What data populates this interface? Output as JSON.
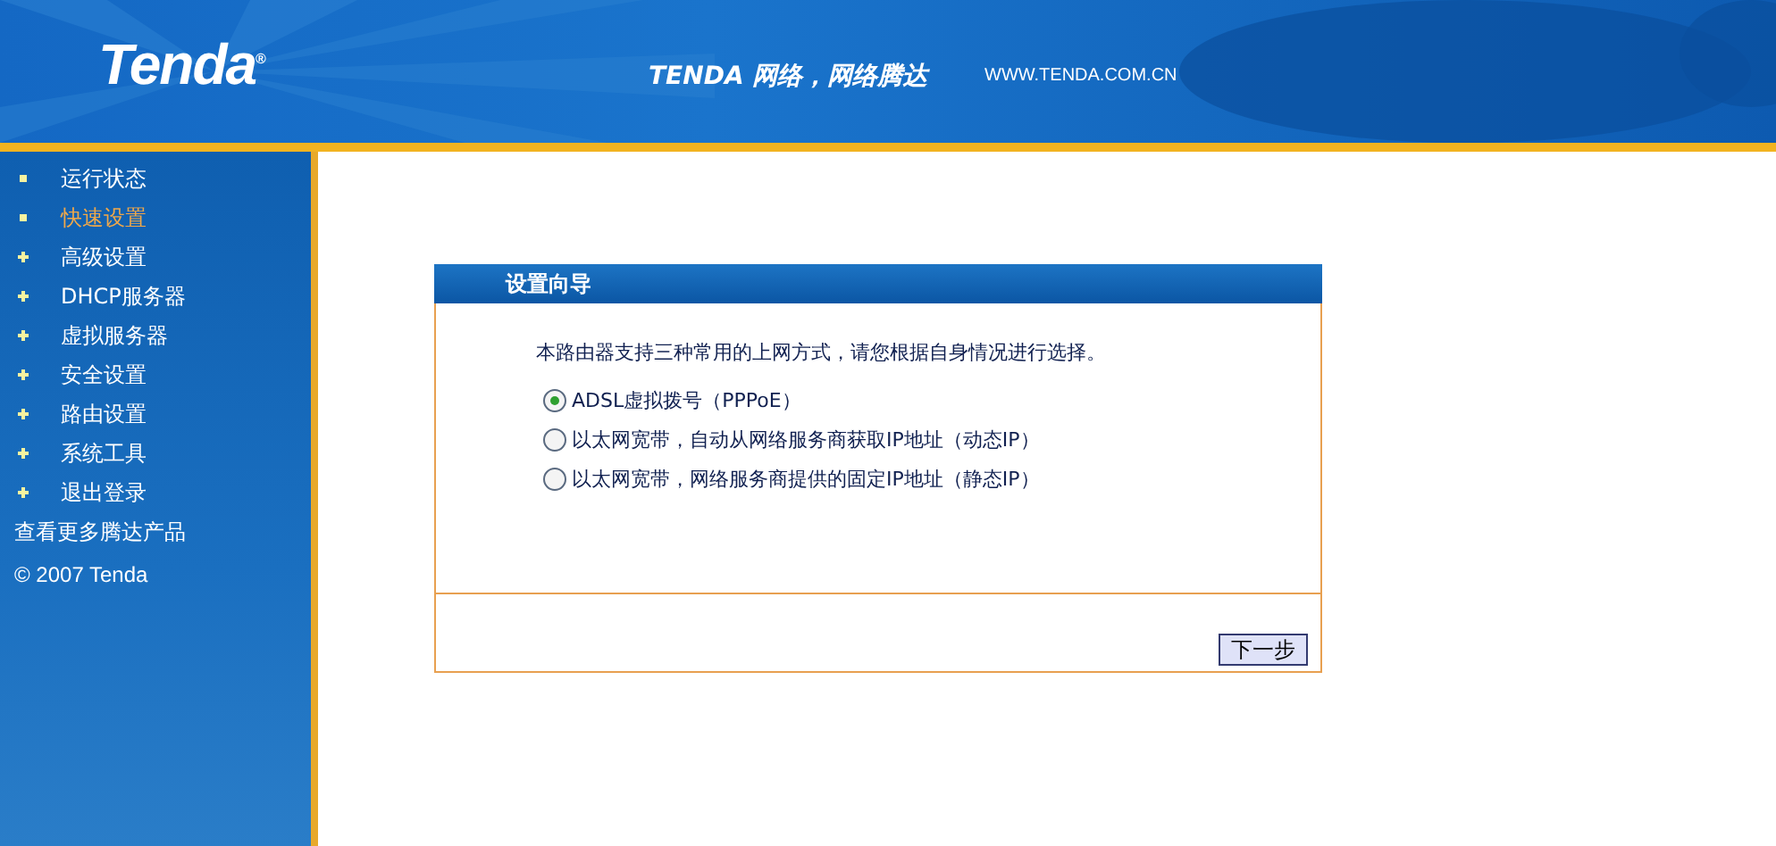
{
  "header": {
    "logo": "Tenda",
    "logo_mark": "®",
    "slogan": "TENDA 网络，网络腾达",
    "url": "WWW.TENDA.COM.CN"
  },
  "sidebar": {
    "items": [
      {
        "label": "运行状态",
        "expandable": false,
        "selected": false
      },
      {
        "label": "快速设置",
        "expandable": false,
        "selected": true
      },
      {
        "label": "高级设置",
        "expandable": true,
        "selected": false
      },
      {
        "label": "DHCP服务器",
        "expandable": true,
        "selected": false
      },
      {
        "label": "虚拟服务器",
        "expandable": true,
        "selected": false
      },
      {
        "label": "安全设置",
        "expandable": true,
        "selected": false
      },
      {
        "label": "路由设置",
        "expandable": true,
        "selected": false
      },
      {
        "label": "系统工具",
        "expandable": true,
        "selected": false
      },
      {
        "label": "退出登录",
        "expandable": true,
        "selected": false
      }
    ],
    "more_link": "查看更多腾达产品",
    "copyright": "© 2007 Tenda"
  },
  "wizard": {
    "title": "设置向导",
    "intro": "本路由器支持三种常用的上网方式，请您根据自身情况进行选择。",
    "options": [
      {
        "label": "ADSL虚拟拨号（PPPoE）",
        "selected": true
      },
      {
        "label": "以太网宽带，自动从网络服务商获取IP地址（动态IP）",
        "selected": false
      },
      {
        "label": "以太网宽带，网络服务商提供的固定IP地址（静态IP）",
        "selected": false
      }
    ],
    "next_button": "下一步"
  }
}
